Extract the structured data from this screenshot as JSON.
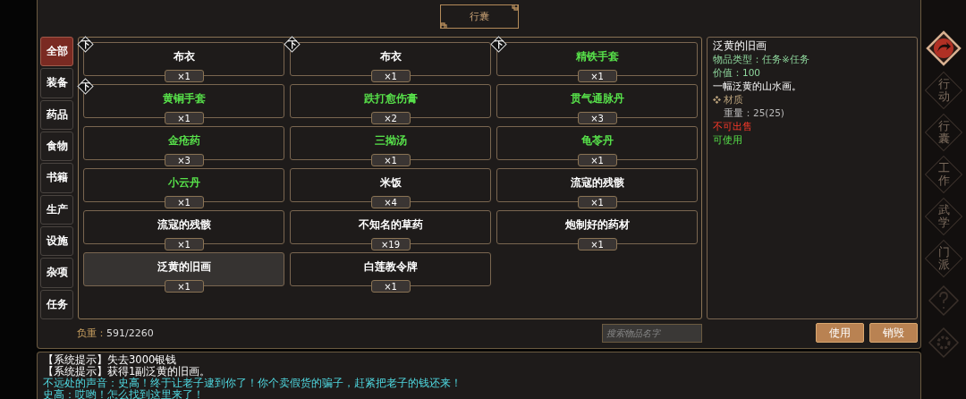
{
  "window": {
    "title": "行囊"
  },
  "categories": [
    {
      "label": "全部",
      "selected": true
    },
    {
      "label": "装备",
      "selected": false
    },
    {
      "label": "药品",
      "selected": false
    },
    {
      "label": "食物",
      "selected": false
    },
    {
      "label": "书籍",
      "selected": false
    },
    {
      "label": "生产",
      "selected": false
    },
    {
      "label": "设施",
      "selected": false
    },
    {
      "label": "杂项",
      "selected": false
    },
    {
      "label": "任务",
      "selected": false
    }
  ],
  "items": [
    {
      "name": "布衣",
      "count": "×1",
      "tag": "下",
      "color": "#ffffff",
      "selected": false
    },
    {
      "name": "布衣",
      "count": "×1",
      "tag": "下",
      "color": "#ffffff",
      "selected": false
    },
    {
      "name": "精铁手套",
      "count": "×1",
      "tag": "下",
      "color": "#57e04a",
      "selected": false
    },
    {
      "name": "黄铜手套",
      "count": "×1",
      "tag": "下",
      "color": "#57e04a",
      "selected": false
    },
    {
      "name": "跌打愈伤膏",
      "count": "×2",
      "color": "#57e04a",
      "selected": false
    },
    {
      "name": "贯气通脉丹",
      "count": "×3",
      "color": "#57e04a",
      "selected": false
    },
    {
      "name": "金疮药",
      "count": "×3",
      "color": "#57e04a",
      "selected": false
    },
    {
      "name": "三拗汤",
      "count": "×1",
      "color": "#57e04a",
      "selected": false
    },
    {
      "name": "龟苓丹",
      "count": "×1",
      "color": "#57e04a",
      "selected": false
    },
    {
      "name": "小云丹",
      "count": "×1",
      "color": "#57e04a",
      "selected": false
    },
    {
      "name": "米饭",
      "count": "×4",
      "color": "#ffffff",
      "selected": false
    },
    {
      "name": "流寇的残骸",
      "count": "×1",
      "color": "#ffffff",
      "selected": false
    },
    {
      "name": "流寇的残骸",
      "count": "×1",
      "color": "#ffffff",
      "selected": false
    },
    {
      "name": "不知名的草药",
      "count": "×19",
      "color": "#ffffff",
      "selected": false
    },
    {
      "name": "炮制好的药材",
      "count": "×1",
      "color": "#ffffff",
      "selected": false
    },
    {
      "name": "泛黄的旧画",
      "count": "×1",
      "color": "#ffffff",
      "selected": true
    },
    {
      "name": "白莲教令牌",
      "count": "×1",
      "color": "#ffffff",
      "selected": false
    }
  ],
  "detail": [
    {
      "kind": "title",
      "text": "泛黄的旧画"
    },
    {
      "kind": "info",
      "text": "物品类型：任务※任务"
    },
    {
      "kind": "info",
      "text": "价值：100"
    },
    {
      "kind": "desc",
      "text": "一幅泛黄的山水画。"
    },
    {
      "kind": "section",
      "text": "材质"
    },
    {
      "kind": "attr",
      "text": "重量：25(25)"
    },
    {
      "kind": "warn",
      "text": "不可出售"
    },
    {
      "kind": "ok",
      "text": "可使用"
    }
  ],
  "load": {
    "label": "负重：",
    "value": "591/2260"
  },
  "search": {
    "placeholder": "搜索物品名字"
  },
  "buttons": [
    "使用",
    "销毁"
  ],
  "log": [
    {
      "kind": "system",
      "text": "【系统提示】失去3000银钱"
    },
    {
      "kind": "system",
      "text": "【系统提示】获得1副泛黄的旧画。"
    },
    {
      "kind": "speech",
      "text": "不远处的声音：史高！终于让老子逮到你了！你个卖假货的骗子，赶紧把老子的钱还来！"
    },
    {
      "kind": "speech",
      "text": "史高：哎哟！怎么找到这里来了！"
    }
  ],
  "side_menu": [
    {
      "kind": "back"
    },
    {
      "kind": "label",
      "label": "行动"
    },
    {
      "kind": "label",
      "label": "行囊"
    },
    {
      "kind": "label",
      "label": "工作"
    },
    {
      "kind": "label",
      "label": "武学"
    },
    {
      "kind": "label",
      "label": "门派"
    },
    {
      "kind": "help"
    },
    {
      "kind": "settings"
    }
  ]
}
